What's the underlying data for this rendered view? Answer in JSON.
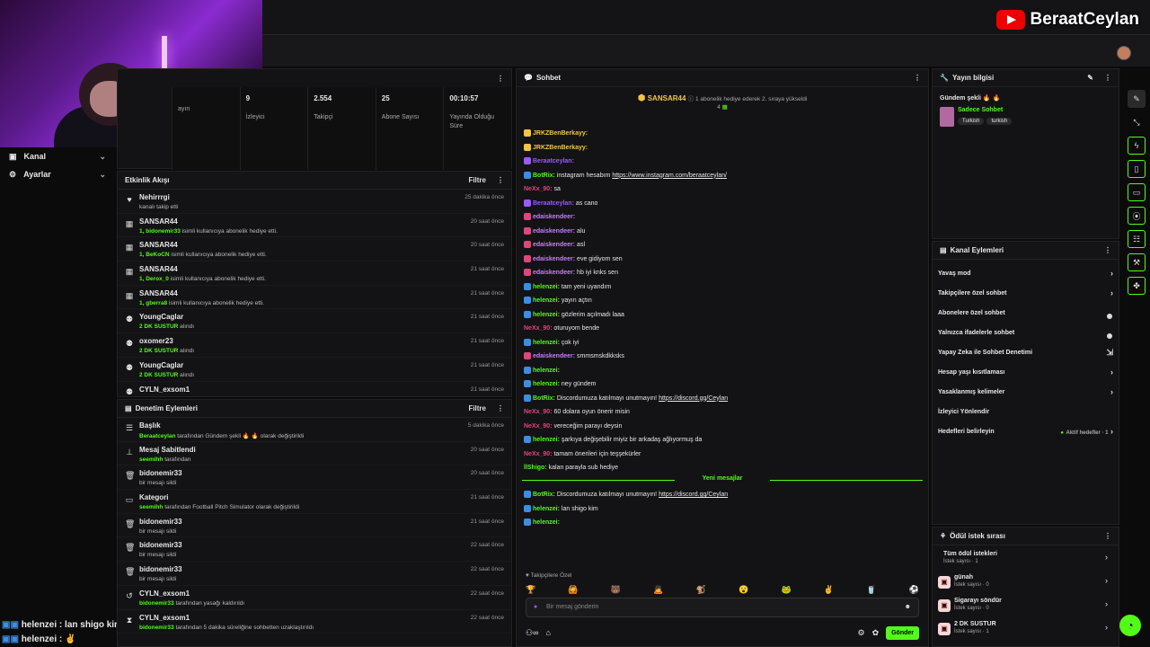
{
  "brand": {
    "name": "BeraatCeylan"
  },
  "nav": [
    {
      "label": "Kanal",
      "icon": "channel-icon"
    },
    {
      "label": "Ayarlar",
      "icon": "gear-icon"
    }
  ],
  "left_chat": [
    {
      "user": "helenzei",
      "text": "lan shigo kim"
    },
    {
      "user": "helenzei",
      "text": ""
    }
  ],
  "stats": [
    {
      "value": "",
      "label": "ayın"
    },
    {
      "value": "9",
      "label": "İzleyici"
    },
    {
      "value": "2.554",
      "label": "Takipçi"
    },
    {
      "value": "25",
      "label": "Abone Sayısı"
    },
    {
      "value": "00:10:57",
      "label": "Yayında Olduğu Süre"
    }
  ],
  "activity": {
    "title": "Etkinlik Akışı",
    "filter": "Filtre",
    "items": [
      {
        "title": "Nehirrrgi",
        "sub": "kanalı takip etti",
        "hl": "",
        "time": "25 dakika önce",
        "icon": "heart-icon",
        "glyph": "♥"
      },
      {
        "title": "SANSAR44",
        "hl": "1, bidonemir33",
        "sub": "isimli kullanıcıya abonelik hediye etti.",
        "time": "20 saat önce",
        "icon": "gift-icon",
        "glyph": "▦"
      },
      {
        "title": "SANSAR44",
        "hl": "1, BeKoCN",
        "sub": "isimli kullanıcıya abonelik hediye etti.",
        "time": "20 saat önce",
        "icon": "gift-icon",
        "glyph": "▦"
      },
      {
        "title": "SANSAR44",
        "hl": "1, Derox_0",
        "sub": "isimli kullanıcıya abonelik hediye etti.",
        "time": "21 saat önce",
        "icon": "gift-icon",
        "glyph": "▦"
      },
      {
        "title": "SANSAR44",
        "hl": "1, gberra8",
        "sub": "isimli kullanıcıya abonelik hediye etti.",
        "time": "21 saat önce",
        "icon": "gift-icon",
        "glyph": "▦"
      },
      {
        "title": "YoungCaglar",
        "hl": "2 DK SUSTUR",
        "sub": "alındı",
        "time": "21 saat önce",
        "icon": "reward-icon",
        "glyph": "⚉"
      },
      {
        "title": "oxomer23",
        "hl": "2 DK SUSTUR",
        "sub": "alındı",
        "time": "21 saat önce",
        "icon": "reward-icon",
        "glyph": "⚉"
      },
      {
        "title": "YoungCaglar",
        "hl": "2 DK SUSTUR",
        "sub": "alındı",
        "time": "21 saat önce",
        "icon": "reward-icon",
        "glyph": "⚉"
      },
      {
        "title": "CYLN_exsom1",
        "hl": "",
        "sub": "",
        "time": "21 saat önce",
        "icon": "reward-icon",
        "glyph": "⚉"
      }
    ]
  },
  "moderation": {
    "title": "Denetim Eylemleri",
    "filter": "Filtre",
    "items": [
      {
        "title": "Başlık",
        "hl": "Beraatceylan",
        "sub": "tarafından Gündem şekli 🔥 🔥 olarak değiştirildi",
        "time": "5 dakika önce",
        "icon": "title-icon",
        "glyph": "☰"
      },
      {
        "title": "Mesaj Sabitlendi",
        "hl": "seemihh",
        "sub": "tarafından",
        "time": "20 saat önce",
        "icon": "pin-icon",
        "glyph": "⊥"
      },
      {
        "title": "bidonemir33",
        "hl": "",
        "sub": "bir mesajı sildi",
        "time": "20 saat önce",
        "icon": "trash-icon",
        "glyph": "🗑"
      },
      {
        "title": "Kategori",
        "hl": "seemihh",
        "sub": "tarafından Football Pitch Simulator olarak değiştirildi",
        "time": "21 saat önce",
        "icon": "category-icon",
        "glyph": "▭"
      },
      {
        "title": "bidonemir33",
        "hl": "",
        "sub": "bir mesajı sildi",
        "time": "21 saat önce",
        "icon": "trash-icon",
        "glyph": "🗑"
      },
      {
        "title": "bidonemir33",
        "hl": "",
        "sub": "bir mesajı sildi",
        "time": "22 saat önce",
        "icon": "trash-icon",
        "glyph": "🗑"
      },
      {
        "title": "bidonemir33",
        "hl": "",
        "sub": "bir mesajı sildi",
        "time": "22 saat önce",
        "icon": "trash-icon",
        "glyph": "🗑"
      },
      {
        "title": "CYLN_exsom1",
        "hl": "bidonemir33",
        "sub": "tarafından yasağı kaldırıldı",
        "time": "22 saat önce",
        "icon": "unban-icon",
        "glyph": "↺"
      },
      {
        "title": "CYLN_exsom1",
        "hl": "bidonemir33",
        "sub": "tarafından 5 dakika süreliğine sohbetten uzaklaştırıldı",
        "time": "22 saat önce",
        "icon": "timeout-icon",
        "glyph": "⧗"
      }
    ]
  },
  "chat": {
    "title": "Sohbet",
    "pinned_user": "SANSAR44",
    "pinned_count": "4",
    "pinned_note": "1 abonelik hediye ederek 2. sıraya yükseldi",
    "new_messages": "Yeni mesajlar",
    "followers_label": "Takipçilere Özel",
    "input_placeholder": "Bir mesaj gönderin",
    "send": "Gönder",
    "messages": [
      {
        "user": "JRKZBenBerkayy:",
        "color": "#f5c542",
        "text": "",
        "badge": "#f5c542"
      },
      {
        "user": "JRKZBenBerkayy:",
        "color": "#f5c542",
        "text": "",
        "badge": "#f5c542"
      },
      {
        "user": "Beraatceylan:",
        "color": "#9b59ff",
        "text": "",
        "badge": "#9b59ff"
      },
      {
        "user": "BotRix:",
        "color": "#53fc18",
        "text": "instagram hesabım ",
        "link": "https://www.instagram.com/beraatceylan/",
        "badge": "#3a8ee6"
      },
      {
        "user": "NeXx_90:",
        "color": "#e0457b",
        "text": "sa",
        "badge": ""
      },
      {
        "user": "Beraatceylan:",
        "color": "#9b59ff",
        "text": "as cano",
        "badge": "#9b59ff"
      },
      {
        "user": "edaiskendeer:",
        "color": "#c77dff",
        "text": "",
        "badge": "#e0457b"
      },
      {
        "user": "edaiskendeer:",
        "color": "#c77dff",
        "text": "alu",
        "badge": "#e0457b"
      },
      {
        "user": "edaiskendeer:",
        "color": "#c77dff",
        "text": "asl",
        "badge": "#e0457b"
      },
      {
        "user": "edaiskendeer:",
        "color": "#c77dff",
        "text": "eve gidiyom sen",
        "badge": "#e0457b"
      },
      {
        "user": "edaiskendeer:",
        "color": "#c77dff",
        "text": "hb iyi knks sen",
        "badge": "#e0457b"
      },
      {
        "user": "helenzei:",
        "color": "#53fc18",
        "text": "tam yeni uyandım",
        "badge": "#3a8ee6"
      },
      {
        "user": "helenzei:",
        "color": "#53fc18",
        "text": "yayın açtın",
        "badge": "#3a8ee6"
      },
      {
        "user": "helenzei:",
        "color": "#53fc18",
        "text": "gözlerim açılmadı laaa",
        "badge": "#3a8ee6"
      },
      {
        "user": "NeXx_90:",
        "color": "#e0457b",
        "text": "oturuyom bende",
        "badge": ""
      },
      {
        "user": "helenzei:",
        "color": "#53fc18",
        "text": "çok iyi",
        "badge": "#3a8ee6"
      },
      {
        "user": "edaiskendeer:",
        "color": "#c77dff",
        "text": "smmsmskdkksks",
        "badge": "#e0457b"
      },
      {
        "user": "helenzei:",
        "color": "#53fc18",
        "text": "",
        "badge": "#3a8ee6"
      },
      {
        "user": "helenzei:",
        "color": "#53fc18",
        "text": "ney gündem",
        "badge": "#3a8ee6"
      },
      {
        "user": "BotRix:",
        "color": "#53fc18",
        "text": "Discordumuza katılmayı unutmayın! ",
        "link": "https://discord.gg/Ceylan",
        "badge": "#3a8ee6"
      },
      {
        "user": "NeXx_90:",
        "color": "#e0457b",
        "text": "60 dolara oyun önerir misin",
        "badge": ""
      },
      {
        "user": "NeXx_90:",
        "color": "#e0457b",
        "text": "vereceğim parayı deysin",
        "badge": ""
      },
      {
        "user": "helenzei:",
        "color": "#53fc18",
        "text": "şarkıya değişebilir miyiz bir arkadaş ağlıyormuş da",
        "badge": "#3a8ee6"
      },
      {
        "user": "NeXx_90:",
        "color": "#e0457b",
        "text": "tamam önerileri için teşşekürler",
        "badge": ""
      },
      {
        "user": "llShigo:",
        "color": "#53fc18",
        "text": "kalan parayla sub hediye",
        "badge": ""
      }
    ],
    "new_msgs": [
      {
        "user": "BotRix:",
        "color": "#53fc18",
        "text": "Discordumuza katılmayı unutmayın! ",
        "link": "https://discord.gg/Ceylan",
        "badge": "#3a8ee6"
      },
      {
        "user": "helenzei:",
        "color": "#53fc18",
        "text": "lan shigo kim",
        "badge": "#3a8ee6"
      },
      {
        "user": "helenzei:",
        "color": "#53fc18",
        "text": "",
        "badge": "#3a8ee6"
      }
    ]
  },
  "stream_info": {
    "title": "Yayın bilgisi",
    "stream_title": "Gündem şekli 🔥 🔥",
    "category": "Sadece Sohbet",
    "tags": [
      "Turkish",
      "turkish"
    ]
  },
  "channel_actions": {
    "title": "Kanal Eylemleri",
    "options": [
      {
        "label": "Yavaş mod",
        "type": "arrow"
      },
      {
        "label": "Takipçilere özel sohbet",
        "type": "arrow"
      },
      {
        "label": "Abonelere özel sohbet",
        "type": "toggle"
      },
      {
        "label": "Yalnızca ifadelerle sohbet",
        "type": "toggle"
      },
      {
        "label": "Yapay Zeka ile Sohbet Denetimi",
        "type": "ext"
      },
      {
        "label": "Hesap yaşı kısıtlaması",
        "type": "arrow"
      },
      {
        "label": "Yasaklanmış kelimeler",
        "type": "arrow"
      },
      {
        "label": "İzleyici Yönlendir",
        "type": "none"
      },
      {
        "label": "Hedefleri belirleyin",
        "type": "goal",
        "note": "Aktif hedefler · 1"
      }
    ]
  },
  "rewards": {
    "title": "Ödül istek sırası",
    "items": [
      {
        "label": "Tüm ödül istekleri",
        "sub": "İstek sayısı · 1",
        "icon": ""
      },
      {
        "label": "günah",
        "sub": "İstek sayısı · 0",
        "icon": "▣"
      },
      {
        "label": "Sigarayı söndür",
        "sub": "İstek sayısı · 0",
        "icon": "▣"
      },
      {
        "label": "2 DK SUSTUR",
        "sub": "İstek sayısı · 1",
        "icon": "▣"
      }
    ]
  }
}
